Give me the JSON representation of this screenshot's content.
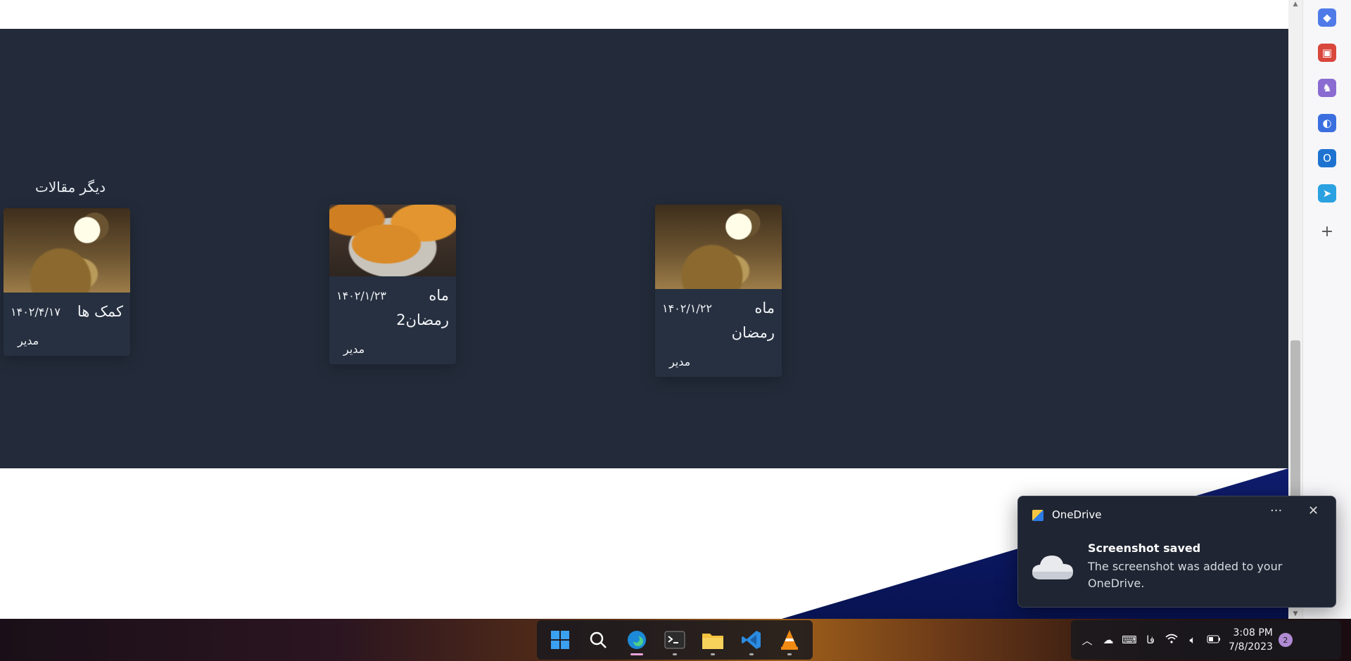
{
  "section": {
    "title": "دیگر مقالات"
  },
  "articles": [
    {
      "title": "کمک ها",
      "date": "۱۴۰۲/۴/۱۷",
      "author": "مدیر",
      "image": "ramadan-crescent-dates"
    },
    {
      "title": "ماه رمضان2",
      "date": "۱۴۰۲/۱/۲۳",
      "author": "مدیر",
      "image": "zoolbia-sweets"
    },
    {
      "title": "ماه رمضان",
      "date": "۱۴۰۲/۱/۲۲",
      "author": "مدیر",
      "image": "ramadan-crescent-dates"
    }
  ],
  "sidebar_icons": [
    "tag-icon",
    "toolbox-icon",
    "games-icon",
    "copilot-icon",
    "outlook-icon",
    "send-icon",
    "add-icon"
  ],
  "toast": {
    "app": "OneDrive",
    "more": "···",
    "close": "✕",
    "title": "Screenshot saved",
    "body": "The screenshot was added to your OneDrive."
  },
  "taskbar": {
    "apps": [
      "windows-start-icon",
      "search-icon",
      "edge-icon",
      "terminal-icon",
      "file-explorer-icon",
      "vscode-icon",
      "vlc-icon"
    ],
    "language": "فا",
    "time": "3:08 PM",
    "date": "7/8/2023",
    "notifications": "2"
  },
  "colors": {
    "section_bg": "#232b3a",
    "card_bg": "#263040",
    "toast_bg": "#1f2532",
    "accent_blue": "#0f1d6e"
  }
}
